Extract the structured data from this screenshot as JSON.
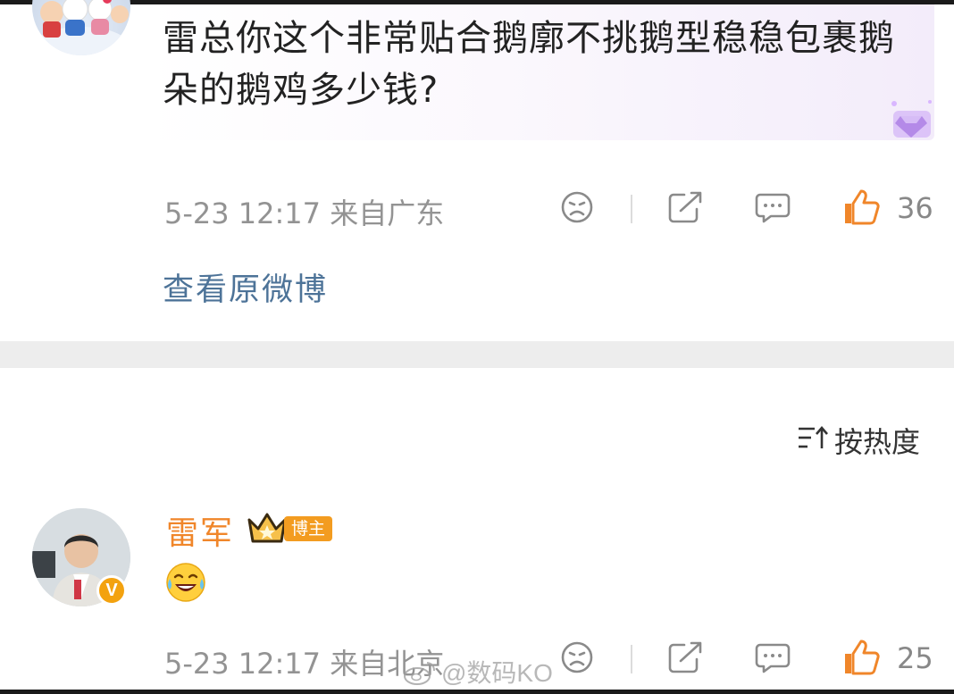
{
  "comment1": {
    "text": "雷总你这个非常贴合鹅廓不挑鹅型稳稳包裹鹅朵的鹅鸡多少钱?",
    "time_location": "5-23 12:17  来自广东",
    "likes": "36",
    "icons": [
      "dislike-face-icon",
      "share-icon",
      "comment-icon",
      "thumbs-up-icon"
    ]
  },
  "view_original": "查看原微博",
  "sort": {
    "label": "按热度",
    "icon": "sort-icon"
  },
  "comment2": {
    "username": "雷军",
    "badge": "博主",
    "verified_mark": "V",
    "reply_emoji": "laughing-crying-emoji",
    "time_location": "5-23 12:17  来自北京",
    "likes": "25"
  },
  "watermark": "@数码KO",
  "colors": {
    "accent_like": "#f0862a",
    "link_blue": "#4d7398",
    "gray_text": "#939393",
    "divider": "#ededed",
    "badge_orange": "#f39c20"
  }
}
